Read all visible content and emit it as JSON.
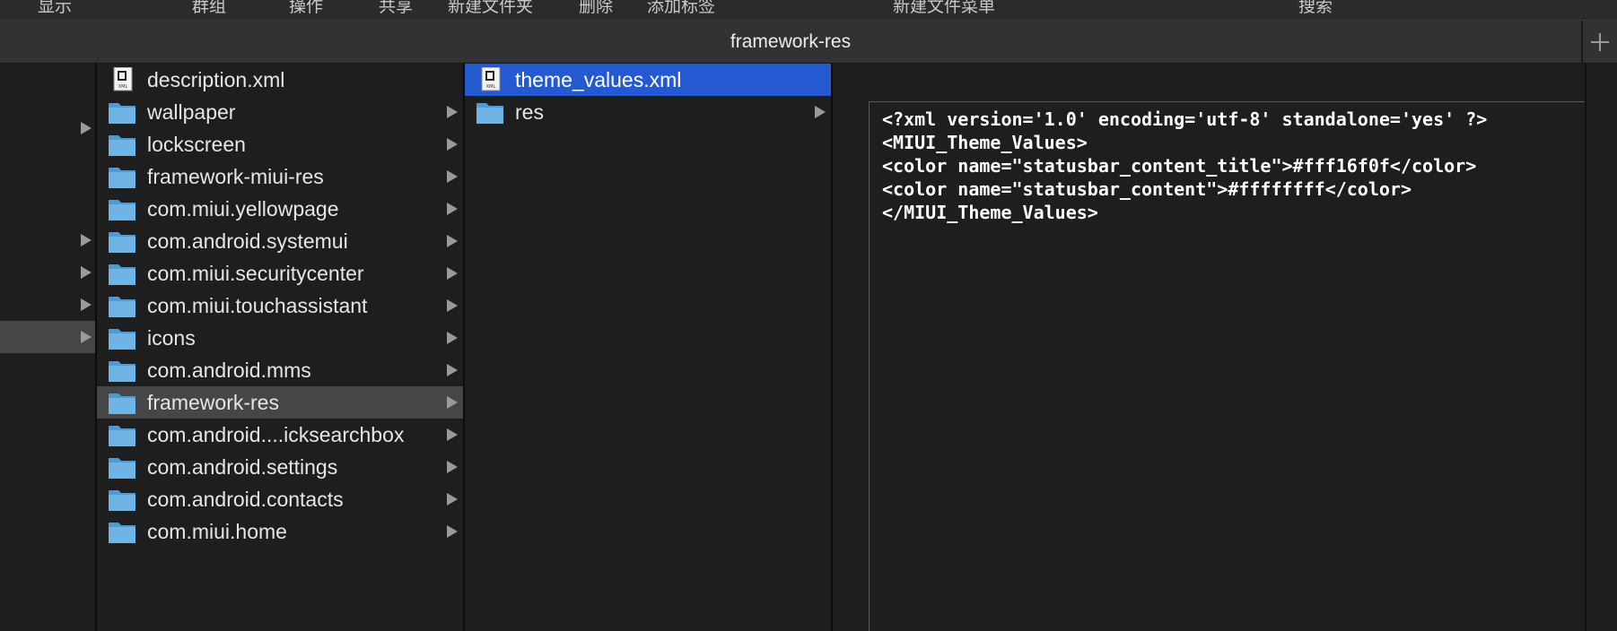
{
  "toolbar": {
    "items": [
      {
        "label": "显示"
      },
      {
        "label": "群组"
      },
      {
        "label": "操作"
      },
      {
        "label": "共享"
      },
      {
        "label": "新建文件夹"
      },
      {
        "label": "删除"
      },
      {
        "label": "添加标签"
      },
      {
        "label": "新建文件菜单"
      },
      {
        "label": "搜索"
      }
    ]
  },
  "tab": {
    "title": "framework-res"
  },
  "columns": {
    "col1": [
      {
        "label": "description.xml",
        "icon": "xml-file-icon"
      },
      {
        "label": "wallpaper",
        "icon": "folder-icon"
      },
      {
        "label": "lockscreen",
        "icon": "folder-icon"
      },
      {
        "label": "framework-miui-res",
        "icon": "folder-icon"
      },
      {
        "label": "com.miui.yellowpage",
        "icon": "folder-icon"
      },
      {
        "label": "com.android.systemui",
        "icon": "folder-icon"
      },
      {
        "label": "com.miui.securitycenter",
        "icon": "folder-icon"
      },
      {
        "label": "com.miui.touchassistant",
        "icon": "folder-icon"
      },
      {
        "label": "icons",
        "icon": "folder-icon"
      },
      {
        "label": "com.android.mms",
        "icon": "folder-icon"
      },
      {
        "label": "framework-res",
        "icon": "folder-icon",
        "selected": true
      },
      {
        "label": "com.android....icksearchbox",
        "icon": "folder-icon"
      },
      {
        "label": "com.android.settings",
        "icon": "folder-icon"
      },
      {
        "label": "com.android.contacts",
        "icon": "folder-icon"
      },
      {
        "label": "com.miui.home",
        "icon": "folder-icon"
      }
    ],
    "col2": [
      {
        "label": "theme_values.xml",
        "icon": "xml-file-icon",
        "selected": true
      },
      {
        "label": "res",
        "icon": "folder-icon"
      }
    ]
  },
  "preview": {
    "content": "<?xml version='1.0' encoding='utf-8' standalone='yes' ?>\n<MIUI_Theme_Values>\n<color name=\"statusbar_content_title\">#fff16f0f</color>\n<color name=\"statusbar_content\">#ffffffff</color>\n</MIUI_Theme_Values>"
  },
  "colors": {
    "selection_blue": "#2459d2",
    "selection_gray": "#464646",
    "folder": "#5fa9dc"
  }
}
